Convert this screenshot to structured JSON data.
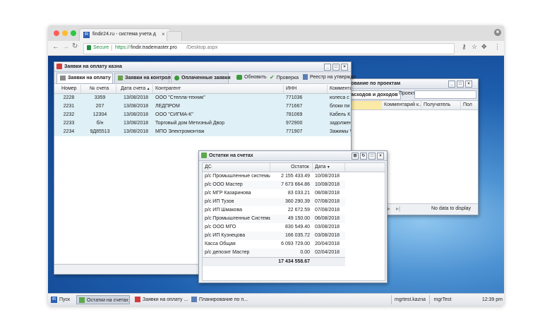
{
  "browser": {
    "tab_title": "findir24.ru - система учета д",
    "secure_label": "Secure",
    "url_prefix": "https://",
    "url_host": "findir.trademaster.pro",
    "url_path": "/Desktop.aspx"
  },
  "win_zayavki": {
    "title": "Заявки на оплату казна",
    "tabs": [
      {
        "label": "Заявки на оплату"
      },
      {
        "label": "Заявки на контроле"
      },
      {
        "label": "Оплаченные заявки"
      }
    ],
    "tools": [
      {
        "label": "Обновить"
      },
      {
        "label": "Проверка"
      },
      {
        "label": "Реестр на утвержде"
      }
    ],
    "columns": [
      "Номер",
      "№ счета",
      "Дата счета",
      "Контрагент",
      "ИНН",
      "Коммента"
    ],
    "rows": [
      {
        "num": "2228",
        "acc": "3359",
        "date": "13/08/2018",
        "agent": "ООО \"Стелла-техник\"",
        "inn": "771036",
        "comment": "колеса с"
      },
      {
        "num": "2231",
        "acc": "207",
        "date": "13/08/2018",
        "agent": "ЛЕДПРОМ",
        "inn": "771667",
        "comment": "блоки пи"
      },
      {
        "num": "2232",
        "acc": "12304",
        "date": "13/08/2018",
        "agent": "ООО \"СИГМА-К\"",
        "inn": "781069",
        "comment": "Кабель К"
      },
      {
        "num": "2233",
        "acc": "б/н",
        "date": "13/08/2018",
        "agent": "Торговый дом Метизный Двор",
        "inn": "972900",
        "comment": "задолжен"
      },
      {
        "num": "2234",
        "acc": "9Д85513",
        "date": "13/08/2018",
        "agent": "МПО Электромонтаж",
        "inn": "771907",
        "comment": "Зажимы V"
      }
    ]
  },
  "win_plan": {
    "title": "рование по проектам",
    "tab_label": "расходов и доходов",
    "project_label": "Проект",
    "columns": [
      "Комментарий к...",
      "Получатель",
      "Пол"
    ],
    "empty_text": "No data to display"
  },
  "win_ostatki": {
    "title": "Остатки на счетах",
    "columns": [
      "ДС",
      "Остаток",
      "Дата"
    ],
    "rows": [
      {
        "ds": "р/с Промышленные системы Б...",
        "amount": "2 155 433.49",
        "date": "10/08/2018"
      },
      {
        "ds": "р/с ООО Мастер",
        "amount": "7 673 664.86",
        "date": "10/08/2018"
      },
      {
        "ds": "р/с МГР Казаринова",
        "amount": "83 033.21",
        "date": "08/08/2018"
      },
      {
        "ds": "р/с ИП Тузов",
        "amount": "360 290.39",
        "date": "07/08/2018"
      },
      {
        "ds": "р/с ИП Шмакова",
        "amount": "22 672.59",
        "date": "07/08/2018"
      },
      {
        "ds": "р/с Промышленные Системы",
        "amount": "49 150.00",
        "date": "06/08/2018"
      },
      {
        "ds": "р/с ООО МГО",
        "amount": "830 549.40",
        "date": "03/08/2018"
      },
      {
        "ds": "р/с ИП Кузнецова",
        "amount": "166 035.72",
        "date": "03/08/2018"
      },
      {
        "ds": "Касса Общая",
        "amount": "6 093 729.00",
        "date": "20/04/2018"
      },
      {
        "ds": "р/с депозит Мастер",
        "amount": "0.00",
        "date": "02/04/2018"
      }
    ],
    "total": "17 434 558.67"
  },
  "taskbar": {
    "start": "Пуск",
    "items": [
      {
        "label": "Остатки на счетах"
      },
      {
        "label": "Заявки на оплату ..."
      },
      {
        "label": "Планирование по п..."
      }
    ],
    "user1": "mgrtest.kazna",
    "user2": "mgrTest",
    "clock": "12:39 pm"
  },
  "colors": {
    "accent_green": "#3a9a3a",
    "selection": "#dff0f6",
    "desktop_blue": "#1e5fae"
  }
}
